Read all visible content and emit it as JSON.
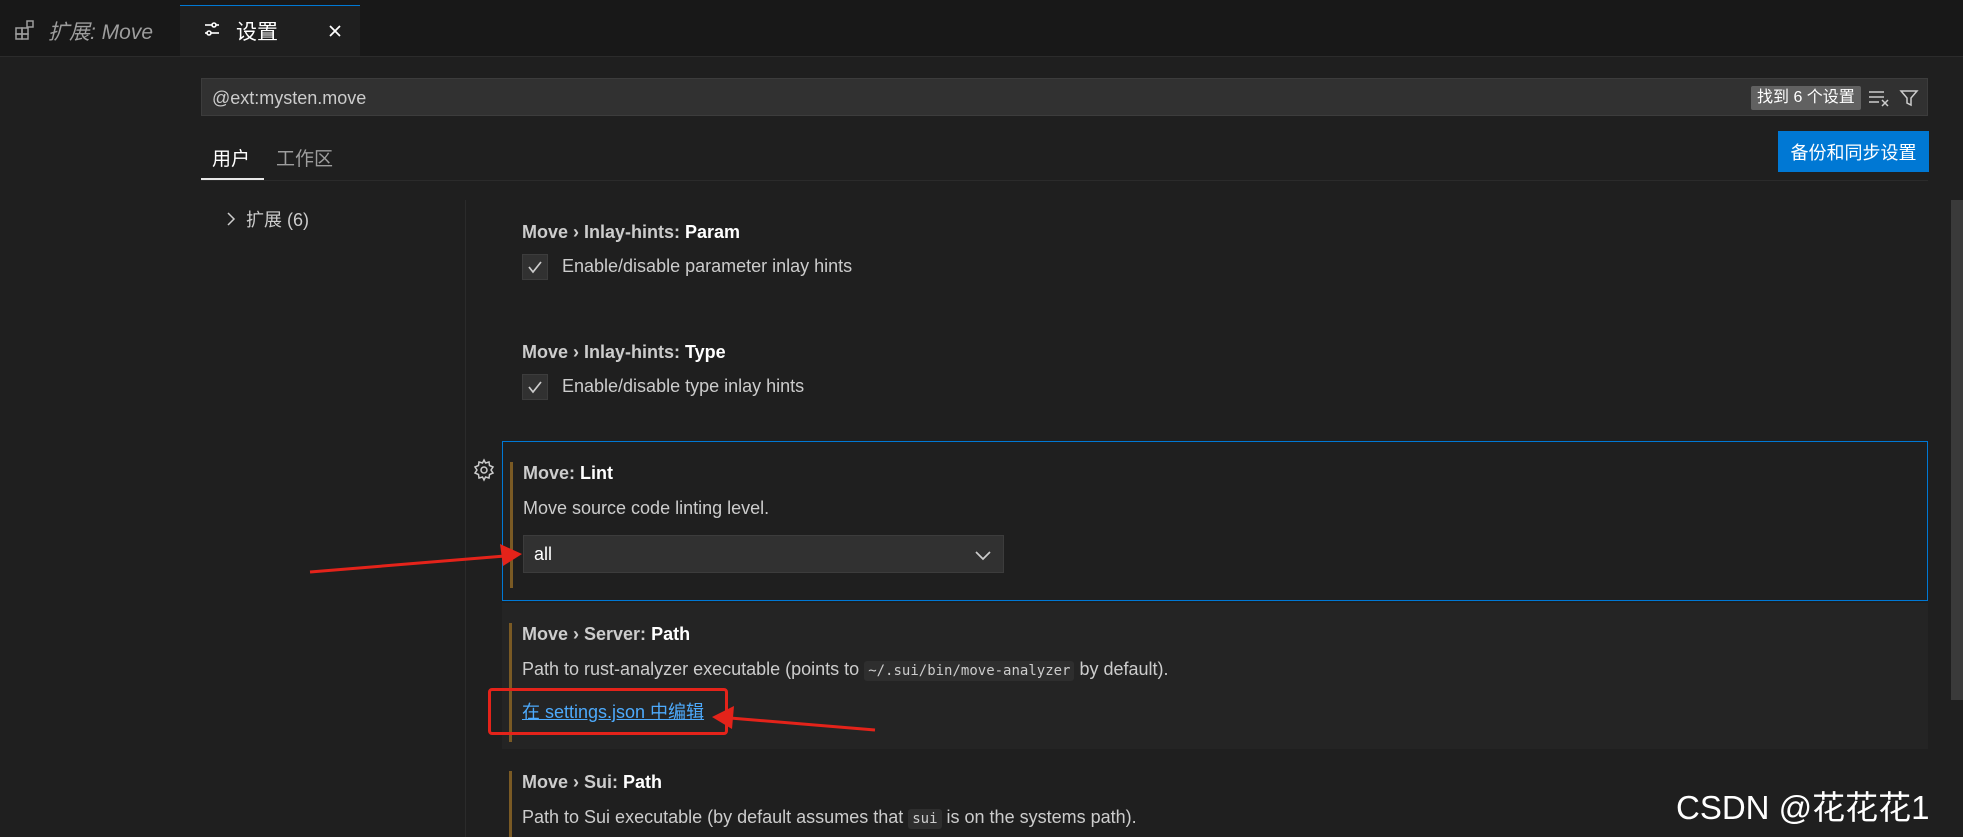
{
  "tabs": [
    {
      "label": "扩展: Move",
      "icon": "extensions-icon"
    },
    {
      "label": "设置",
      "icon": "settings-sliders-icon",
      "close_icon": "close-icon"
    }
  ],
  "search": {
    "value": "@ext:mysten.move",
    "result_badge": "找到 6 个设置",
    "clear_icon": "clear-filter-icon",
    "filter_icon": "filter-icon"
  },
  "scope_tabs": [
    {
      "label": "用户",
      "active": true
    },
    {
      "label": "工作区",
      "active": false
    }
  ],
  "sync_button": "备份和同步设置",
  "tree": {
    "items": [
      {
        "label": "扩展 (6)"
      }
    ]
  },
  "settings": [
    {
      "category": "Move › Inlay-hints: ",
      "key": "Param",
      "description": "Enable/disable parameter inlay hints",
      "checked": true
    },
    {
      "category": "Move › Inlay-hints: ",
      "key": "Type",
      "description": "Enable/disable type inlay hints",
      "checked": true
    },
    {
      "category": "Move: ",
      "key": "Lint",
      "description": "Move source code linting level.",
      "selected_value": "all"
    },
    {
      "category": "Move › Server: ",
      "key": "Path",
      "description_pre": "Path to rust-analyzer executable (points to ",
      "description_code": "~/.sui/bin/move-analyzer",
      "description_post": " by default).",
      "link_text": "在 settings.json 中编辑"
    },
    {
      "category": "Move › Sui: ",
      "key": "Path",
      "description_pre": "Path to Sui executable (by default assumes that ",
      "description_code": "sui",
      "description_post": " is on the systems path)."
    }
  ],
  "watermark": "CSDN @花花花1",
  "colors": {
    "accent": "#0078d4",
    "annotation": "#e4231a",
    "link": "#4daafc"
  }
}
